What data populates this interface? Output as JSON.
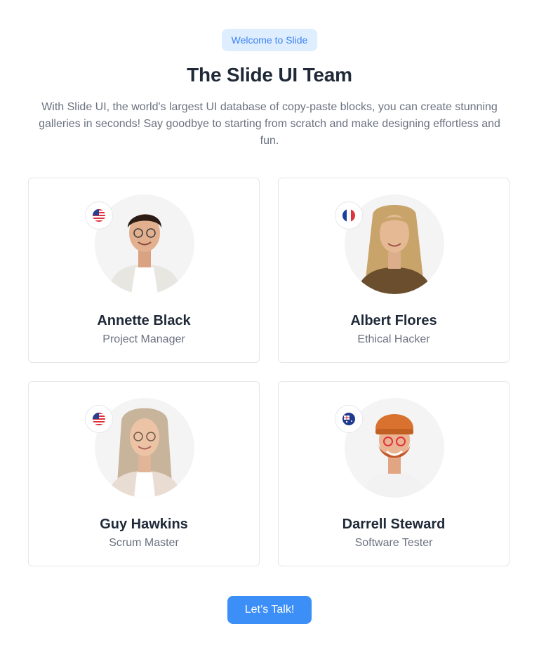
{
  "header": {
    "badge": "Welcome to Slide",
    "title": "The Slide UI Team",
    "intro": "With Slide UI, the world's largest UI database of copy-paste blocks, you can create stunning galleries in seconds! Say goodbye to starting from scratch and make designing effortless and fun."
  },
  "team": [
    {
      "name": "Annette Black",
      "role": "Project Manager",
      "flag": "us-flag-icon"
    },
    {
      "name": "Albert Flores",
      "role": "Ethical Hacker",
      "flag": "fr-flag-icon"
    },
    {
      "name": "Guy Hawkins",
      "role": "Scrum Master",
      "flag": "us-flag-icon"
    },
    {
      "name": "Darrell Steward",
      "role": "Software Tester",
      "flag": "au-flag-icon"
    }
  ],
  "cta": {
    "label": "Let’s Talk!"
  },
  "colors": {
    "accent": "#3b8ff6",
    "badge_bg": "#dfeefe",
    "badge_text": "#3b82f6",
    "heading": "#1f2937",
    "muted": "#6b7280",
    "card_border": "#e5e7eb"
  }
}
